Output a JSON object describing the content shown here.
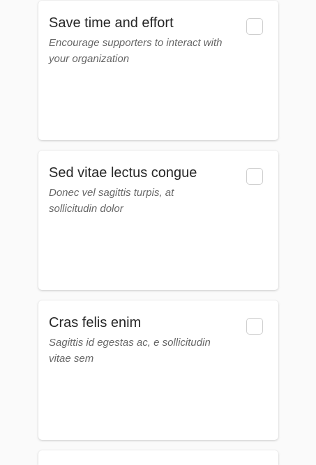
{
  "cards": [
    {
      "title": "Save time and effort",
      "description": "Encourage supporters to interact with your organization",
      "checked": false
    },
    {
      "title": "Sed vitae lectus congue",
      "description": "Donec vel sagittis turpis, at sollicitudin dolor",
      "checked": false
    },
    {
      "title": "Cras felis enim",
      "description": "Sagittis id egestas ac, e sollicitudin vitae sem",
      "checked": false
    },
    {
      "title": "",
      "description": "",
      "checked": false
    }
  ]
}
